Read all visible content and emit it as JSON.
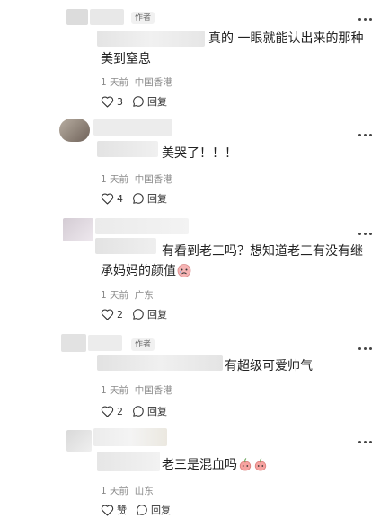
{
  "author_tag": "作者",
  "reply_label": "回复",
  "comments": [
    {
      "text_line1": "真的 一眼就能认出来的那种",
      "text_line2": "美到窒息",
      "time": "1 天前",
      "location": "中国香港",
      "likes": "3"
    },
    {
      "text_line1": "美哭了！！！",
      "time": "1 天前",
      "location": "中国香港",
      "likes": "4"
    },
    {
      "text_line1": "有看到老三吗？想知道老三有没有继",
      "text_line2": "承妈妈的颜值",
      "time": "1 天前",
      "location": "广东",
      "likes": "2"
    },
    {
      "text_line1": "有超级可爱帅气",
      "time": "1 天前",
      "location": "中国香港",
      "likes": "2"
    },
    {
      "text_line1": "老三是混血吗",
      "time": "1 天前",
      "location": "山东",
      "likes": "赞"
    }
  ]
}
